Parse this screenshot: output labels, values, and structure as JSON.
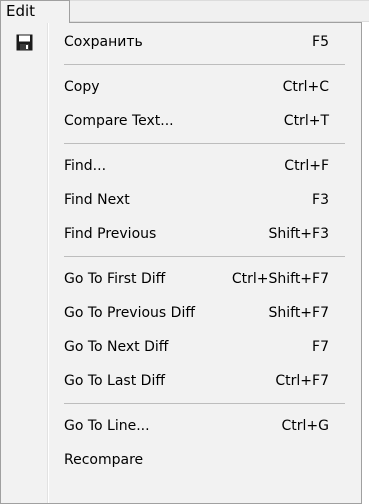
{
  "menubar": {
    "title": "Edit"
  },
  "menu": {
    "items": [
      {
        "label": "Сохранить",
        "shortcut": "F5",
        "icon": "save-icon"
      },
      {
        "label": "Copy",
        "shortcut": "Ctrl+C"
      },
      {
        "label": "Compare Text...",
        "shortcut": "Ctrl+T"
      },
      {
        "label": "Find...",
        "shortcut": "Ctrl+F"
      },
      {
        "label": "Find Next",
        "shortcut": "F3"
      },
      {
        "label": "Find Previous",
        "shortcut": "Shift+F3"
      },
      {
        "label": "Go To First Diff",
        "shortcut": "Ctrl+Shift+F7"
      },
      {
        "label": "Go To Previous Diff",
        "shortcut": "Shift+F7"
      },
      {
        "label": "Go To Next Diff",
        "shortcut": "F7"
      },
      {
        "label": "Go To Last Diff",
        "shortcut": "Ctrl+F7"
      },
      {
        "label": "Go To Line...",
        "shortcut": "Ctrl+G"
      },
      {
        "label": "Recompare",
        "shortcut": ""
      }
    ]
  },
  "colors": {
    "menu_background": "#f2f2f2",
    "separator": "#bdbdbd",
    "border": "#a0a0a0"
  }
}
